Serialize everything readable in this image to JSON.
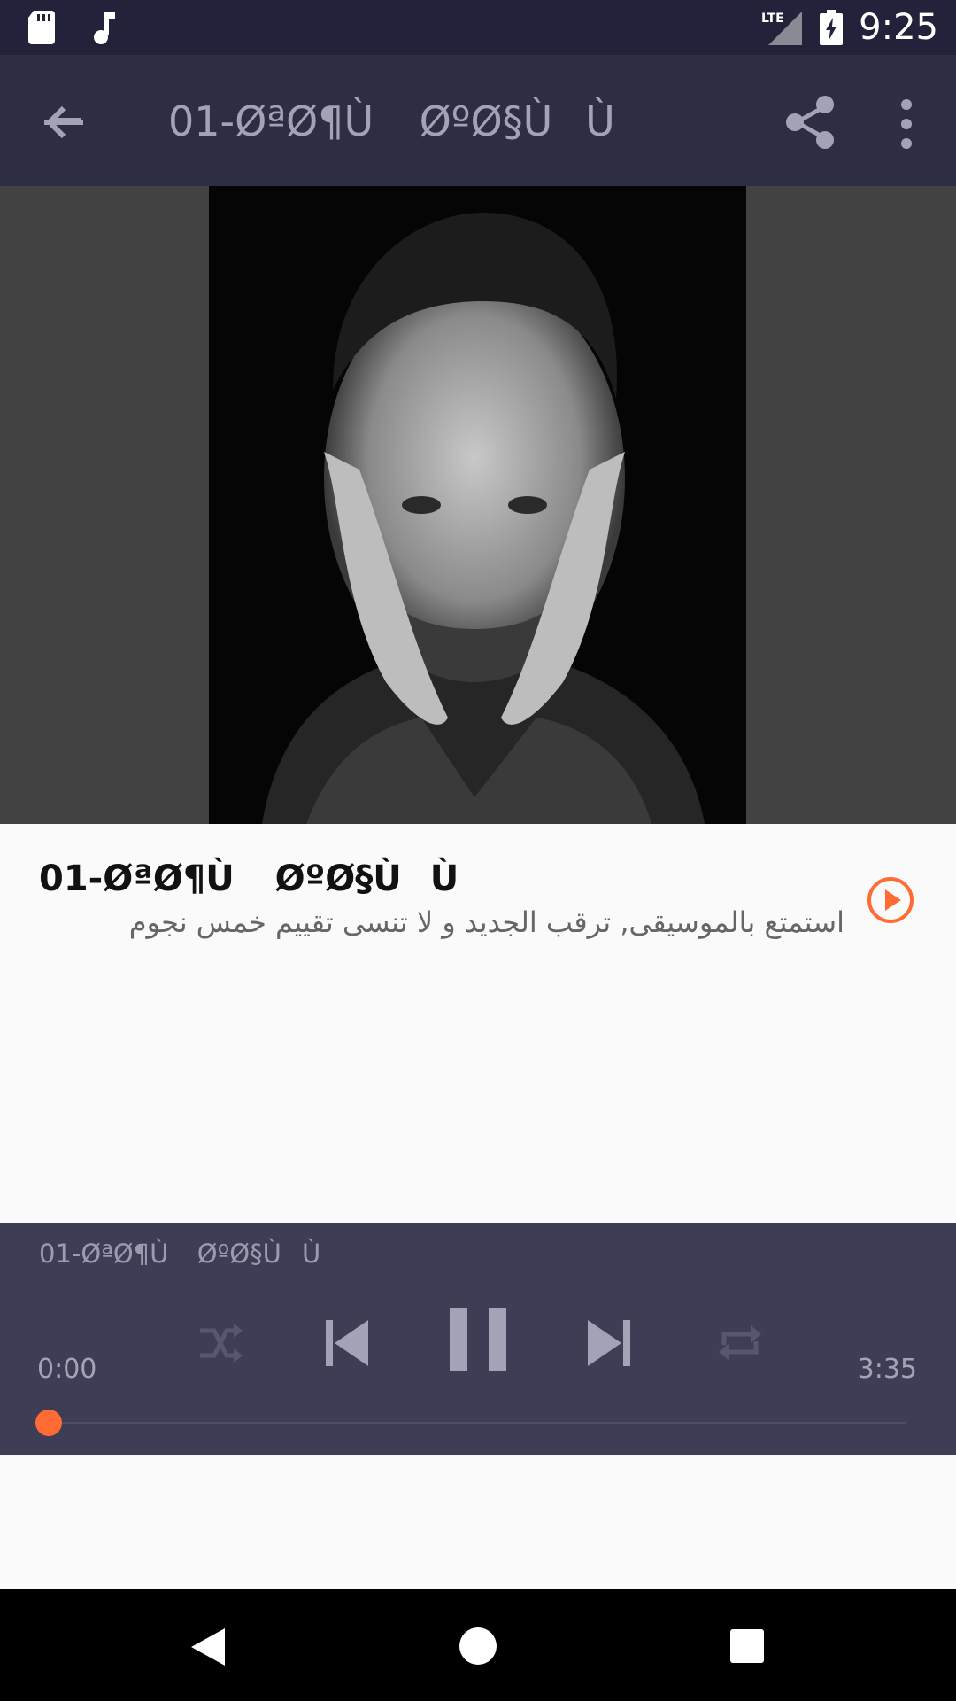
{
  "status_bar": {
    "time": "9:25",
    "network": "LTE",
    "icons": [
      "sd-card-icon",
      "music-note-icon",
      "signal-icon",
      "battery-charging-icon"
    ]
  },
  "toolbar": {
    "title": "01-ØªØ¶Ù ØºØ§ÙÙ",
    "icons": [
      "back-arrow-icon",
      "share-icon",
      "more-vert-icon"
    ]
  },
  "song": {
    "title": "01-ØªØ¶Ù ØºØ§ÙÙ",
    "subtitle": "استمتع بالموسيقى, ترقب الجديد و لا تنسى تقييم خمس نجوم"
  },
  "player": {
    "now_playing": "01-ØªØ¶Ù ØºØ§ÙÙ",
    "elapsed": "0:00",
    "duration": "3:35",
    "progress": 0.0,
    "controls": [
      "shuffle-icon",
      "skip-previous-icon",
      "pause-icon",
      "skip-next-icon",
      "repeat-icon"
    ]
  },
  "colors": {
    "accent": "#ff6b35",
    "toolbar_bg": "#2d2d44",
    "player_bg": "#3d3d56",
    "status_bg": "#22233a"
  }
}
